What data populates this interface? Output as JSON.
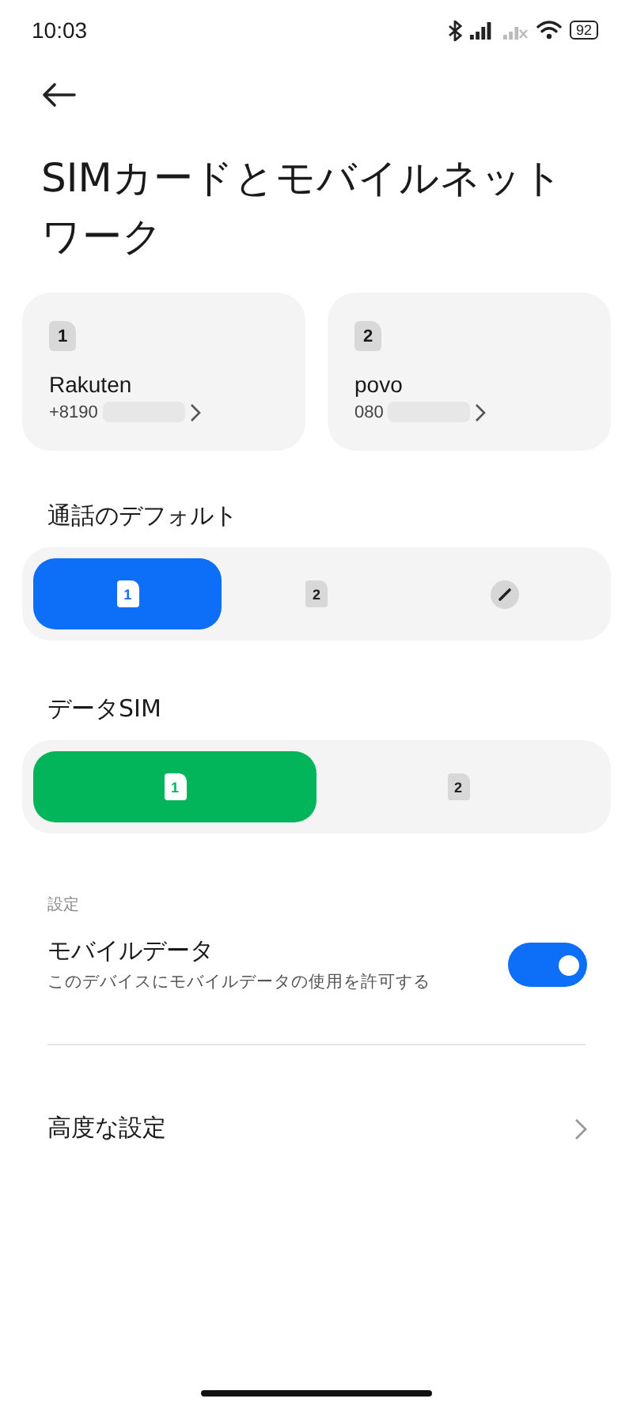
{
  "status_bar": {
    "time": "10:03",
    "battery": "92"
  },
  "title": "SIMカードとモバイルネットワーク",
  "sim_cards": [
    {
      "slot": "1",
      "carrier": "Rakuten",
      "number": "+8190",
      "redacted": true
    },
    {
      "slot": "2",
      "carrier": "povo",
      "number": "080",
      "redacted": true
    }
  ],
  "sections": [
    {
      "label": "通話のデフォルト",
      "kind": "call",
      "options": [
        {
          "kind": "sim",
          "label": "1",
          "selected": true
        },
        {
          "kind": "sim",
          "label": "2",
          "selected": false
        },
        {
          "kind": "edit",
          "selected": false
        }
      ]
    },
    {
      "label": "データSIM",
      "kind": "data",
      "options": [
        {
          "kind": "sim",
          "label": "1",
          "selected": true
        },
        {
          "kind": "sim",
          "label": "2",
          "selected": false
        }
      ]
    }
  ],
  "settings_header": "設定",
  "mobile_data": {
    "title": "モバイルデータ",
    "subtitle": "このデバイスにモバイルデータの使用を許可する",
    "on": true
  },
  "advanced": {
    "label": "高度な設定"
  }
}
